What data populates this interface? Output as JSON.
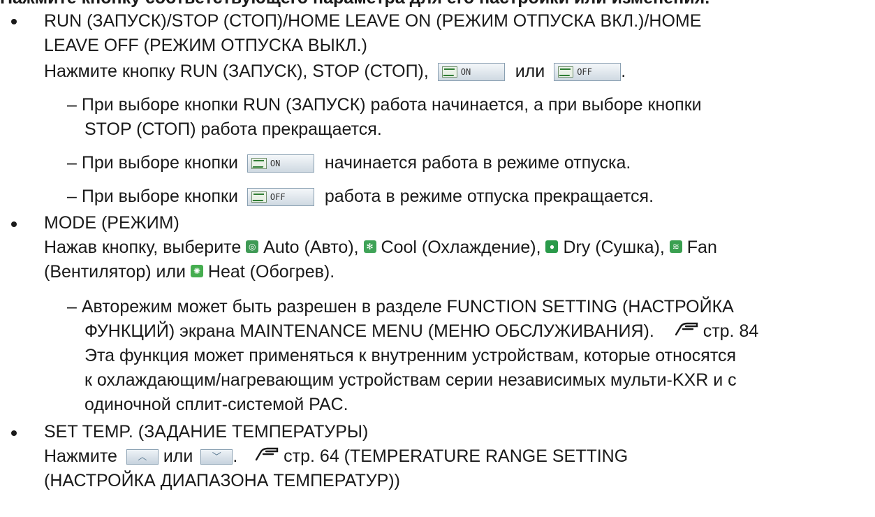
{
  "header": {
    "text": "Нажмите кнопку соответствующего параметра для его настройки или изменения."
  },
  "run": {
    "title_l1": "RUN (ЗАПУСК)/STOP (СТОП)/HOME LEAVE ON (РЕЖИМ ОТПУСКА ВКЛ.)/HOME",
    "title_l2": "LEAVE OFF (РЕЖИМ ОТПУСКА ВЫКЛ.)",
    "press_prefix": "Нажмите кнопку RUN (ЗАПУСК), STOP (СТОП),",
    "or": "или",
    "period": ".",
    "on_btn": "ON",
    "off_btn": "OFF",
    "sub1_l1": "– При выборе кнопки RUN (ЗАПУСК) работа начинается, а при выборе кнопки",
    "sub1_l2": "STOP (СТОП) работа прекращается.",
    "sub2_prefix": "– При выборе кнопки",
    "sub2_suffix": "начинается работа в режиме отпуска.",
    "sub3_prefix": "– При выборе кнопки",
    "sub3_suffix": "работа в режиме отпуска прекращается."
  },
  "mode": {
    "title": "MODE (РЕЖИМ)",
    "l1_prefix": "Нажав кнопку, выберите",
    "auto": "Auto (Авто),",
    "cool": "Cool (Охлаждение),",
    "dry": "Dry (Сушка),",
    "fan": "Fan",
    "l2_prefix": "(Вентилятор) или",
    "heat": "Heat (Обогрев).",
    "icons": {
      "auto": "auto-mode-icon",
      "cool": "cool-mode-icon",
      "dry": "dry-mode-icon",
      "fan": "fan-mode-icon",
      "heat": "heat-mode-icon"
    },
    "colors": {
      "auto": "#3f9a55",
      "cool": "#3fa357",
      "dry": "#2a9a4a",
      "fan": "#3aa050",
      "heat": "#45ad4f"
    },
    "note_l1": "– Авторежим может быть разрешен в разделе FUNCTION SETTING (НАСТРОЙКА",
    "note_l2": "ФУНКЦИЙ) экрана MAINTENANCE MENU (МЕНЮ ОБСЛУЖИВАНИЯ).",
    "note_ref": "стр. 84",
    "note_l3": "Эта функция может применяться к внутренним устройствам, которые относятся",
    "note_l4": "к охлаждающим/нагревающим устройствам серии независимых мульти-KXR и с",
    "note_l5": "одиночной сплит-системой PAC."
  },
  "temp": {
    "title": "SET TEMP. (ЗАДАНИЕ ТЕМПЕРАТУРЫ)",
    "press": "Нажмите",
    "or": "или",
    "period": ".",
    "up_glyph": "︿",
    "down_glyph": "﹀",
    "ref_l1": "стр. 64 (TEMPERATURE RANGE SETTING",
    "ref_l2": "(НАСТРОЙКА ДИАПАЗОНА ТЕМПЕРАТУР))"
  }
}
